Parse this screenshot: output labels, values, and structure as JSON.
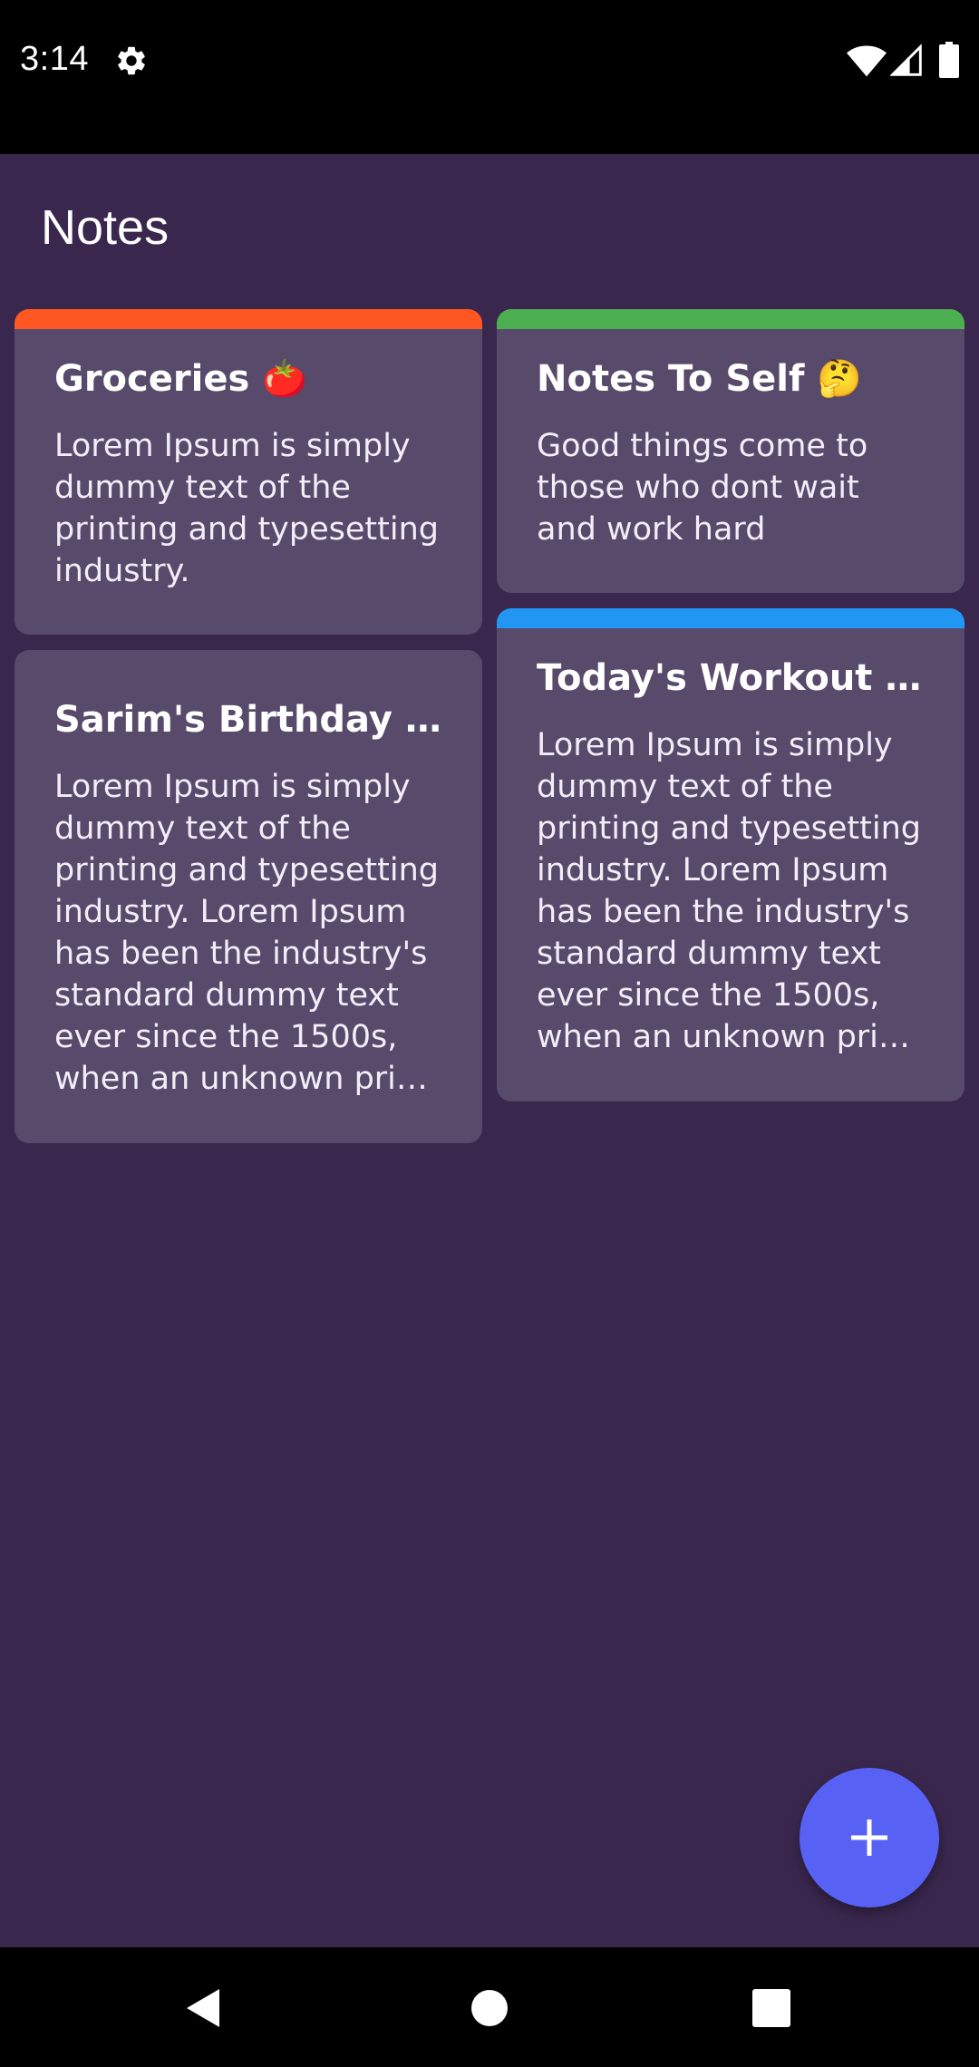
{
  "status_bar": {
    "time": "3:14",
    "icons": [
      "gear-icon",
      "wifi-icon",
      "signal-icon",
      "battery-icon"
    ]
  },
  "app": {
    "title": "Notes",
    "background": "#3a274e",
    "card_color": "#574a6b"
  },
  "notes": [
    {
      "title": "Groceries 🍅",
      "body": "Lorem Ipsum is simply dummy text of the printing and typesetting industry.",
      "accent": "#ff5722"
    },
    {
      "title": "Notes To Self 🤔",
      "body": "Good things come to those who dont wait and work hard",
      "accent": "#4caf50"
    },
    {
      "title": "Sarim's Birthday P…",
      "body": "Lorem Ipsum is simply dummy text of the printing and typesetting industry. Lorem Ipsum has been the industry's standard dummy text ever since the 1500s, when an unknown pri…",
      "accent": null
    },
    {
      "title": "Today's Workout 💪",
      "body": "Lorem Ipsum is simply dummy text of the printing and typesetting industry. Lorem Ipsum has been the industry's standard dummy text ever since the 1500s, when an unknown pri…",
      "accent": "#2196f3"
    }
  ],
  "fab": {
    "icon": "plus-icon",
    "color": "#5762f5"
  },
  "nav_bar": {
    "icons": [
      "back-icon",
      "home-icon",
      "recents-icon"
    ]
  }
}
